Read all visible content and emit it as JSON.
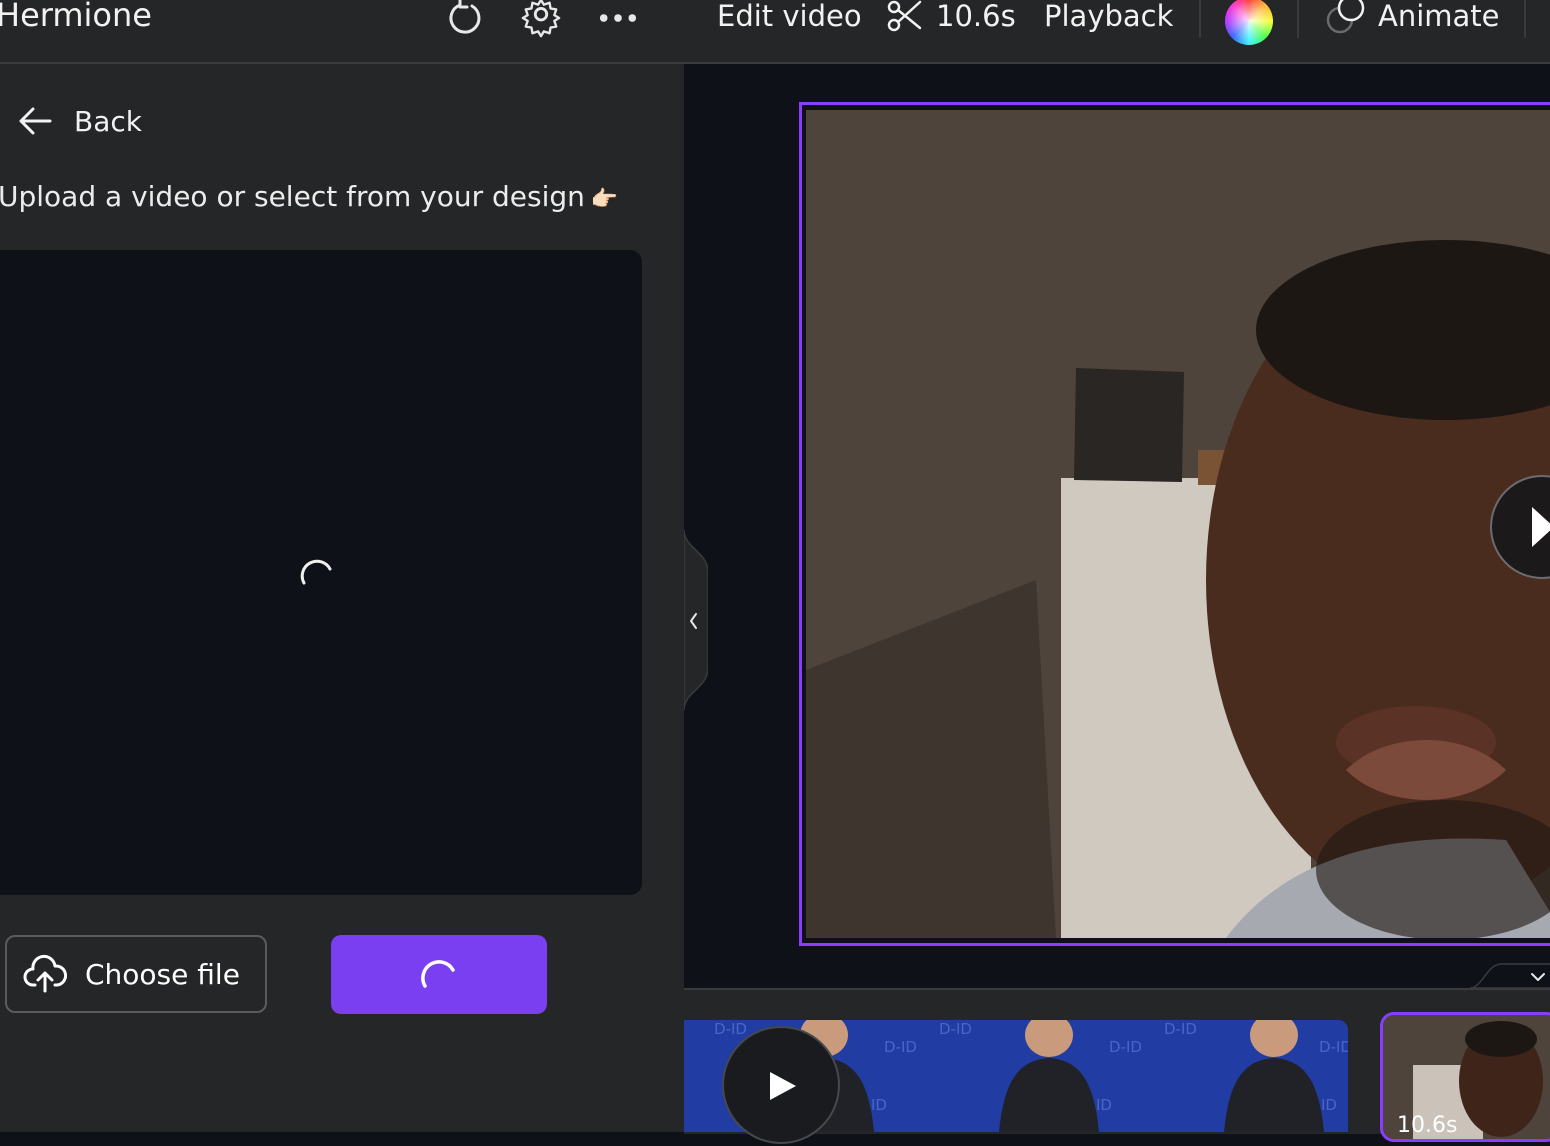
{
  "app": {
    "name": "Hermione"
  },
  "left_panel": {
    "back_label": "Back",
    "instruction": "Upload a video or select from your design",
    "instruction_emoji": "👉🏻",
    "choose_file_label": "Choose file"
  },
  "toolbar": {
    "edit_video_label": "Edit video",
    "duration_label": "10.6s",
    "playback_label": "Playback",
    "animate_label": "Animate"
  },
  "timeline": {
    "selected_clip_duration": "10.6s",
    "watermark_text": "D-ID"
  },
  "colors": {
    "accent": "#8b3dff",
    "primary_button": "#7b3ff2",
    "panel_bg": "#252627",
    "canvas_bg": "#0e1117"
  }
}
